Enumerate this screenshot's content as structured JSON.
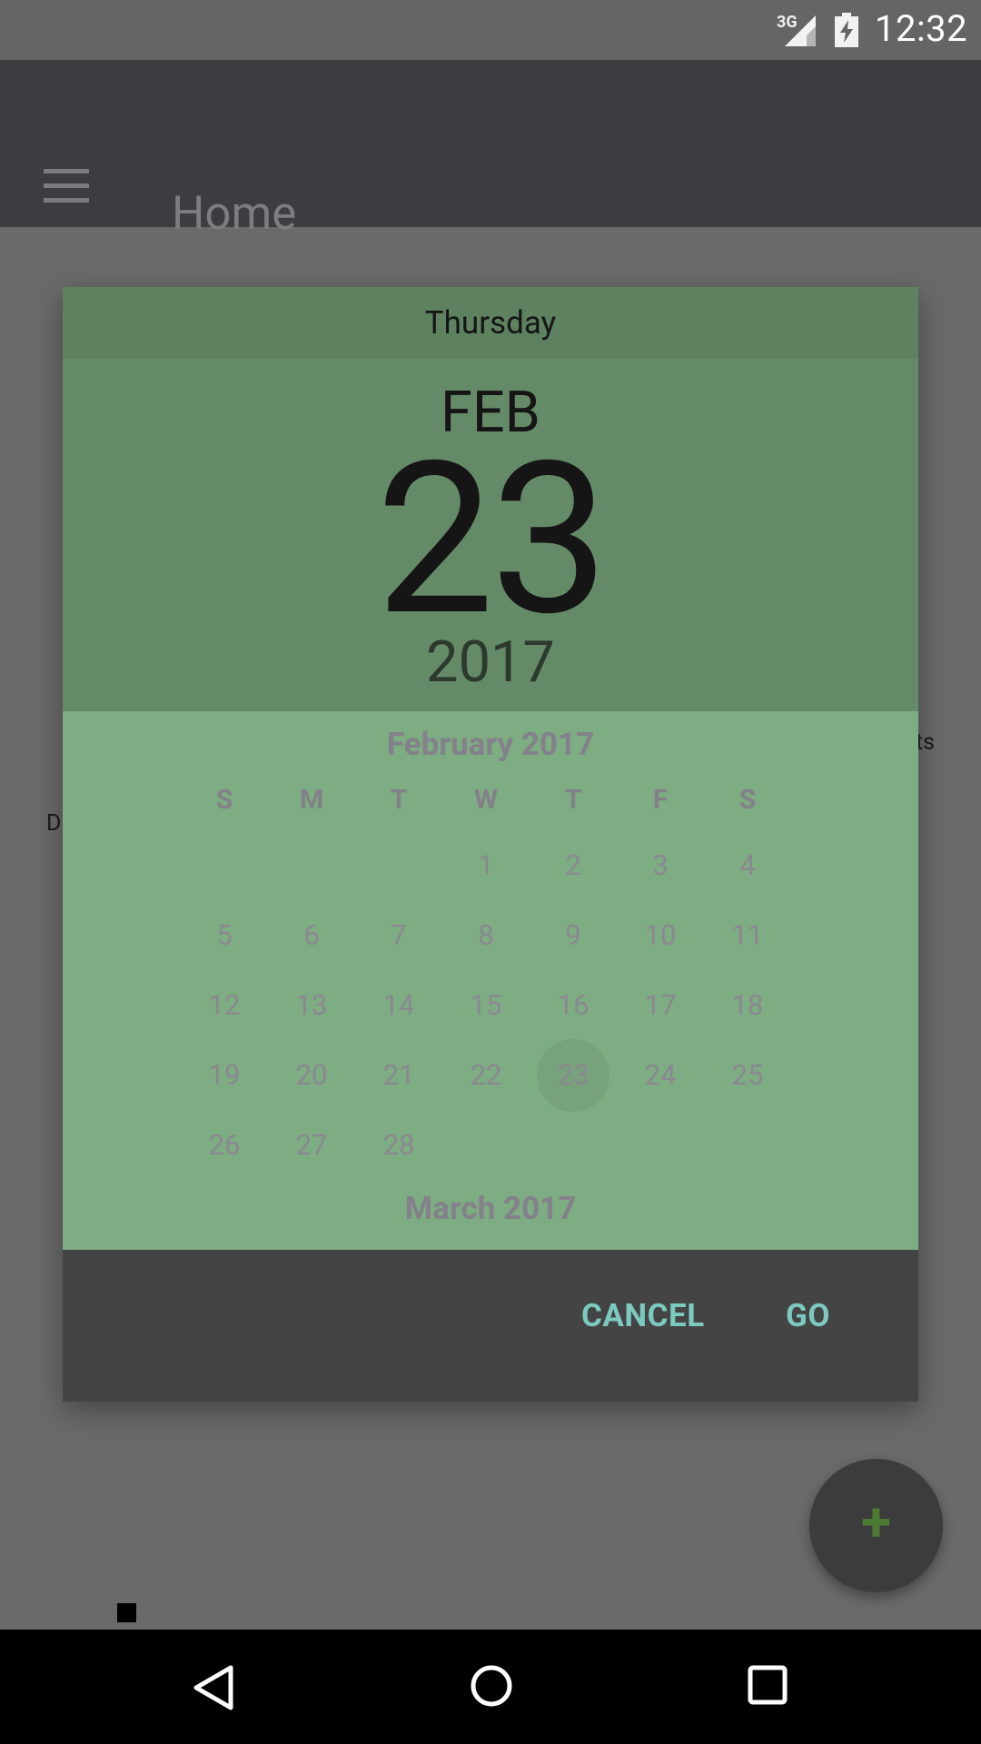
{
  "status_bar": {
    "network": "3G",
    "time": "12:32",
    "signal_icon": "signal-icon",
    "battery_icon": "battery-charging-icon"
  },
  "app_bar": {
    "title": "Home",
    "menu_icon": "menu-icon"
  },
  "background": {
    "left_text": "D",
    "right_text": "ts"
  },
  "dialog": {
    "weekday": "Thursday",
    "month_short": "FEB",
    "day": "23",
    "year": "2017",
    "calendar": {
      "month_title": "February 2017",
      "day_headers": [
        "S",
        "M",
        "T",
        "W",
        "T",
        "F",
        "S"
      ],
      "weeks": [
        [
          "",
          "",
          "",
          "1",
          "2",
          "3",
          "4"
        ],
        [
          "5",
          "6",
          "7",
          "8",
          "9",
          "10",
          "11"
        ],
        [
          "12",
          "13",
          "14",
          "15",
          "16",
          "17",
          "18"
        ],
        [
          "19",
          "20",
          "21",
          "22",
          "23",
          "24",
          "25"
        ],
        [
          "26",
          "27",
          "28",
          "",
          "",
          "",
          ""
        ]
      ],
      "selected_day": "23",
      "next_month_title": "March 2017"
    },
    "cancel_label": "CANCEL",
    "go_label": "GO"
  },
  "fab": {
    "icon": "plus-icon",
    "label": "+"
  },
  "nav_bar": {
    "back_icon": "back-icon",
    "home_icon": "home-icon",
    "recents_icon": "recents-icon"
  },
  "colors": {
    "header_dark": "#5e8260",
    "header": "#658a67",
    "calendar_bg": "#7eac83",
    "accent_button": "#7cc9c0",
    "fab_plus": "#4c7a31"
  }
}
